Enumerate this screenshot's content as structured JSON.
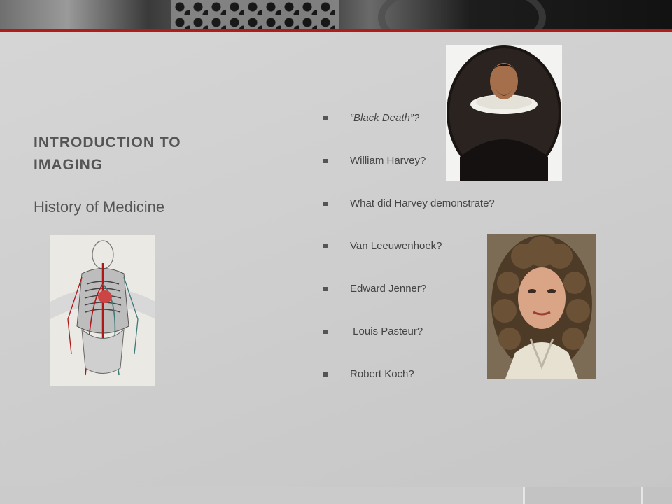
{
  "slide": {
    "title": "INTRODUCTION TO IMAGING",
    "subtitle": "History of Medicine",
    "accent_color": "#b31b1b"
  },
  "bullets": [
    {
      "text": "“Black Death”?",
      "italic": true
    },
    {
      "text": "William Harvey?",
      "italic": false
    },
    {
      "text": "What did Harvey demonstrate?",
      "italic": false
    },
    {
      "text": "Van Leeuwenhoek?",
      "italic": false
    },
    {
      "text": "Edward Jenner?",
      "italic": false
    },
    {
      "text": " Louis Pasteur?",
      "italic": false
    },
    {
      "text": "Robert Koch?",
      "italic": false
    }
  ],
  "images": {
    "anatomy": "anatomical-circulatory-illustration",
    "harvey": "william-harvey-portrait",
    "leeuwenhoek": "van-leeuwenhoek-portrait"
  }
}
